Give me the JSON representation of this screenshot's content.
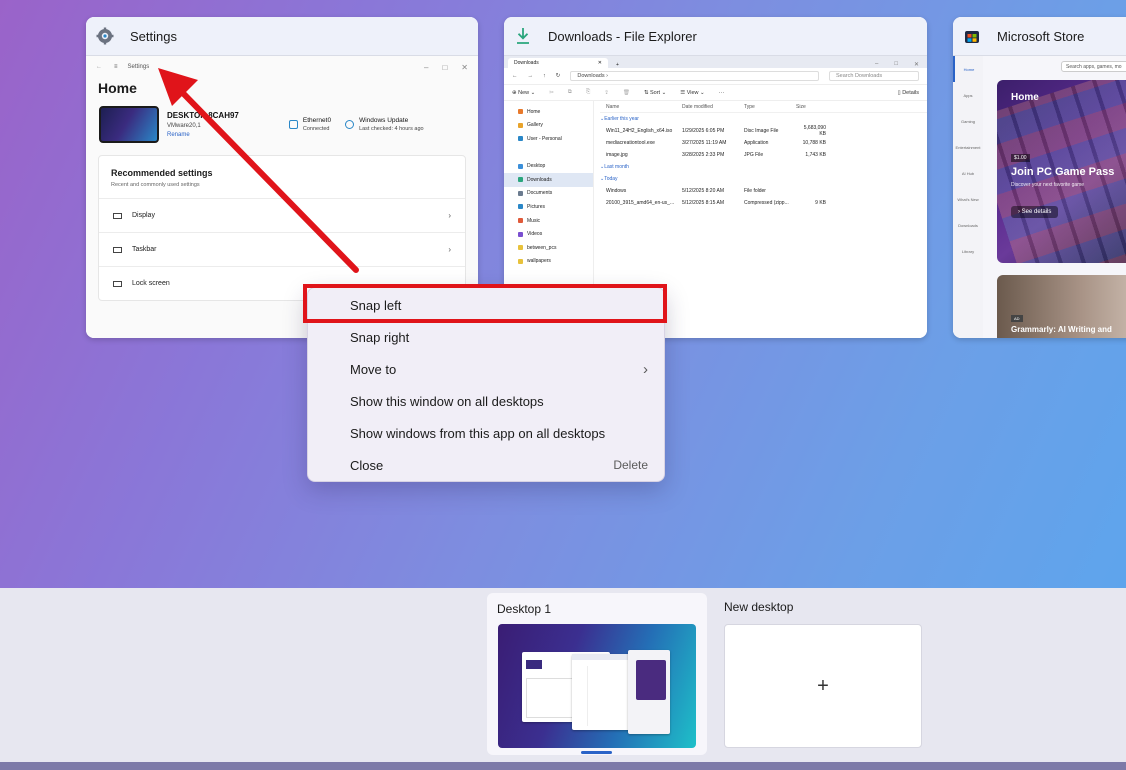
{
  "windows": {
    "settings": {
      "title": "Settings",
      "breadcrumb": "Settings",
      "page_title": "Home",
      "device_name": "DESKTOP-8CAH97",
      "device_model": "VMware20,1",
      "rename_link": "Rename",
      "network_name": "Ethernet0",
      "network_status": "Connected",
      "update_name": "Windows Update",
      "update_status": "Last checked: 4 hours ago",
      "recommended_title": "Recommended settings",
      "recommended_sub": "Recent and commonly used settings",
      "rows": [
        "Display",
        "Taskbar",
        "Lock screen"
      ]
    },
    "explorer": {
      "title": "Downloads - File Explorer",
      "tab_label": "Downloads",
      "address": "Downloads",
      "search_placeholder": "Search Downloads",
      "toolbar": {
        "new": "New",
        "sort": "Sort",
        "view": "View",
        "details": "Details"
      },
      "nav": [
        {
          "label": "Home",
          "color": "#e8792b"
        },
        {
          "label": "Gallery",
          "color": "#e8a32b"
        },
        {
          "label": "User - Personal",
          "color": "#2a87c7"
        },
        {
          "label": "",
          "color": ""
        },
        {
          "label": "Desktop",
          "color": "#3b8fd9"
        },
        {
          "label": "Downloads",
          "color": "#2aa67d"
        },
        {
          "label": "Documents",
          "color": "#6b7b8f"
        },
        {
          "label": "Pictures",
          "color": "#2a87c7"
        },
        {
          "label": "Music",
          "color": "#e05a3a"
        },
        {
          "label": "Videos",
          "color": "#7a4fd0"
        },
        {
          "label": "between_pcs",
          "color": "#e8c23b"
        },
        {
          "label": "wallpapers",
          "color": "#e8c23b"
        }
      ],
      "columns": [
        "Name",
        "Date modified",
        "Type",
        "Size"
      ],
      "groups": [
        {
          "label": "Earlier this year",
          "files": [
            {
              "name": "Win11_24H2_English_x64.iso",
              "date": "1/29/2025 6:05 PM",
              "type": "Disc Image File",
              "size": "5,683,090 KB"
            },
            {
              "name": "mediacreationtool.exe",
              "date": "3/27/2025 11:19 AM",
              "type": "Application",
              "size": "10,788 KB"
            },
            {
              "name": "image.jpg",
              "date": "3/28/2025 2:33 PM",
              "type": "JPG File",
              "size": "1,743 KB"
            }
          ]
        },
        {
          "label": "Last month",
          "files": []
        },
        {
          "label": "Today",
          "files": [
            {
              "name": "Windows",
              "date": "5/12/2025 8:20 AM",
              "type": "File folder",
              "size": ""
            },
            {
              "name": "20100_3915_amd64_en-us_...",
              "date": "5/12/2025 8:15 AM",
              "type": "Compressed (zipp...",
              "size": "9 KB"
            }
          ]
        }
      ]
    },
    "store": {
      "title": "Microsoft Store",
      "search_placeholder": "Search apps, games, mo",
      "hero_title": "Home",
      "hero_price": "$1.00",
      "hero_heading": "Join PC Game Pass",
      "hero_desc": "Discover your next favorite game",
      "hero_button": "See details",
      "card2_tag": "AD",
      "card2_title": "Grammarly: AI Writing and",
      "nav": [
        "Home",
        "Apps",
        "Gaming",
        "Entertainment",
        "AI Hub",
        "What's New",
        "Downloads",
        "Library"
      ]
    }
  },
  "context_menu": {
    "items": [
      {
        "label": "Snap left",
        "shortcut": "",
        "has_submenu": false
      },
      {
        "label": "Snap right",
        "shortcut": "",
        "has_submenu": false
      },
      {
        "label": "Move to",
        "shortcut": "",
        "has_submenu": true
      },
      {
        "label": "Show this window on all desktops",
        "shortcut": "",
        "has_submenu": false
      },
      {
        "label": "Show windows from this app on all desktops",
        "shortcut": "",
        "has_submenu": false
      },
      {
        "label": "Close",
        "shortcut": "Delete",
        "has_submenu": false
      }
    ],
    "highlighted_item": "Snap left"
  },
  "desktops": {
    "current_label": "Desktop 1",
    "new_label": "New desktop",
    "new_glyph": "+"
  },
  "colors": {
    "highlight_box": "#e0141a",
    "arrow": "#e0141a",
    "accent": "#2a63c7"
  }
}
